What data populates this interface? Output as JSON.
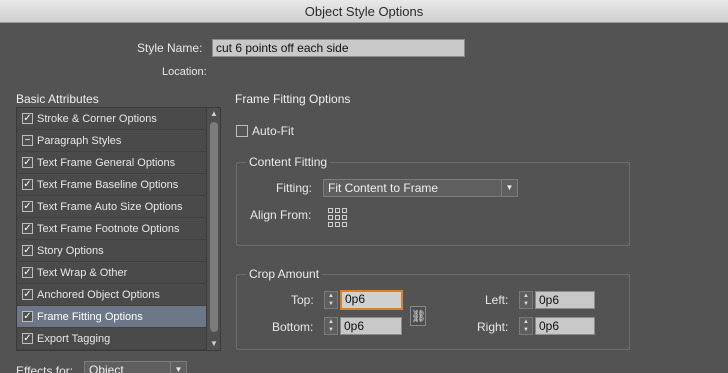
{
  "window": {
    "title": "Object Style Options"
  },
  "style_name": {
    "label": "Style Name:",
    "value": "cut 6 points off each side"
  },
  "location": {
    "label": "Location:"
  },
  "basic_attributes": {
    "header": "Basic Attributes",
    "items": [
      {
        "label": "Stroke & Corner Options",
        "state": "checked"
      },
      {
        "label": "Paragraph Styles",
        "state": "mixed"
      },
      {
        "label": "Text Frame General Options",
        "state": "checked"
      },
      {
        "label": "Text Frame Baseline Options",
        "state": "checked"
      },
      {
        "label": "Text Frame Auto Size Options",
        "state": "checked"
      },
      {
        "label": "Text Frame Footnote Options",
        "state": "checked"
      },
      {
        "label": "Story Options",
        "state": "checked"
      },
      {
        "label": "Text Wrap & Other",
        "state": "checked"
      },
      {
        "label": "Anchored Object Options",
        "state": "checked"
      },
      {
        "label": "Frame Fitting Options",
        "state": "checked",
        "selected": true
      },
      {
        "label": "Export Tagging",
        "state": "checked"
      }
    ]
  },
  "effects_for": {
    "label": "Effects for:",
    "value": "Object"
  },
  "frame_fitting": {
    "header": "Frame Fitting Options",
    "auto_fit_label": "Auto-Fit",
    "content_fitting": {
      "title": "Content Fitting",
      "fitting_label": "Fitting:",
      "fitting_value": "Fit Content to Frame",
      "align_from_label": "Align From:"
    },
    "crop_amount": {
      "title": "Crop Amount",
      "top_label": "Top:",
      "top_value": "0p6",
      "bottom_label": "Bottom:",
      "bottom_value": "0p6",
      "left_label": "Left:",
      "left_value": "0p6",
      "right_label": "Right:",
      "right_value": "0p6"
    }
  },
  "colors": {
    "selected_row": "#6c7787",
    "focus_ring": "#d9822b",
    "panel_bg": "#535353"
  },
  "icons": {
    "checkmark": "✓",
    "mixed": "−",
    "scroll_up": "▲",
    "scroll_down": "▼",
    "dropdown": "▼",
    "spin_up": "▲",
    "spin_down": "▼",
    "chain_link": "⛓"
  }
}
